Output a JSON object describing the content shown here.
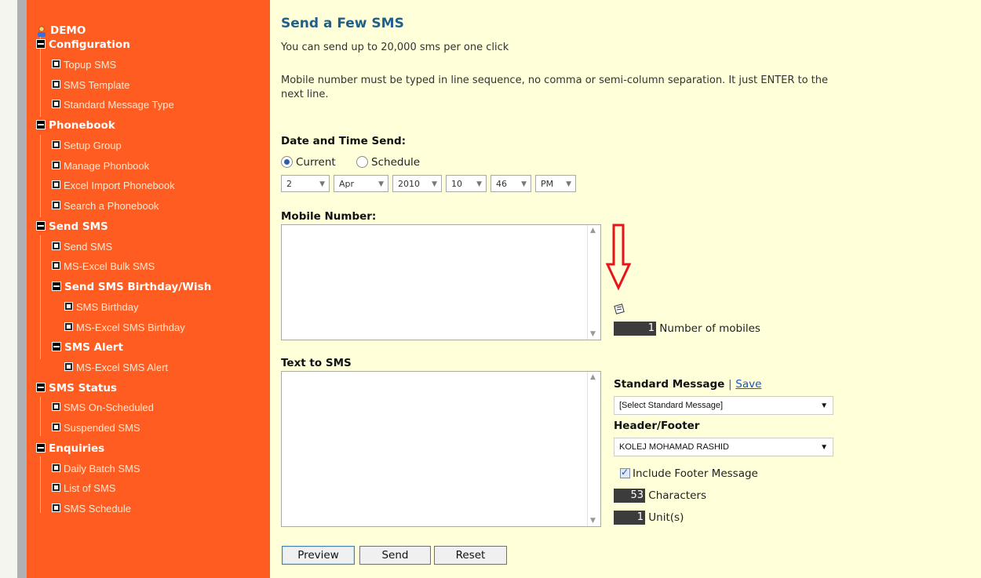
{
  "sidebar": {
    "demo": "DEMO",
    "configuration": "Configuration",
    "topup_sms": "Topup SMS",
    "sms_template": "SMS Template",
    "standard_message_type": "Standard Message Type",
    "phonebook": "Phonebook",
    "setup_group": "Setup Group",
    "manage_phonebook": "Manage Phonbook",
    "excel_import_phonebook": "Excel Import Phonebook",
    "search_phonebook": "Search a Phonebook",
    "send_sms_group": "Send SMS",
    "send_sms": "Send SMS",
    "ms_excel_bulk": "MS-Excel Bulk SMS",
    "send_birthday": "Send SMS Birthday/Wish",
    "sms_birthday": "SMS Birthday",
    "ms_excel_birthday": "MS-Excel SMS Birthday",
    "sms_alert": "SMS Alert",
    "ms_excel_alert": "MS-Excel SMS Alert",
    "sms_status": "SMS Status",
    "sms_on_scheduled": "SMS On-Scheduled",
    "suspended_sms": "Suspended SMS",
    "enquiries": "Enquiries",
    "daily_batch": "Daily Batch SMS",
    "list_of_sms": "List of SMS",
    "sms_schedule": "SMS Schedule"
  },
  "main": {
    "title": "Send a Few SMS",
    "subtitle": "You can send up to 20,000 sms per one click",
    "instruction_line1": "Mobile number must be typed in line sequence, no comma or semi-column separation. It just ENTER to the",
    "instruction_line2": "next line.",
    "date_time_label": "Date and Time Send:",
    "radio_current": "Current",
    "radio_schedule": "Schedule",
    "day": "2",
    "month": "Apr",
    "year": "2010",
    "hour": "10",
    "minute": "46",
    "ampm": "PM",
    "mobile_label": "Mobile Number:",
    "mobile_count": "1",
    "mobile_count_label": "Number of mobiles",
    "text_label": "Text to SMS",
    "standard_message_label": "Standard Message",
    "separator": "|",
    "save_link": "Save",
    "standard_message_value": "[Select Standard Message]",
    "header_footer_label": "Header/Footer",
    "header_footer_value": "KOLEJ MOHAMAD RASHID",
    "include_footer": "Include Footer Message",
    "characters_count": "53",
    "characters_label": "Characters",
    "units_count": "1",
    "units_label": "Unit(s)",
    "preview_button": "Preview",
    "send_button": "Send",
    "reset_button": "Reset"
  },
  "colors": {
    "sidebar_bg": "#ff5c21",
    "page_bg": "#ffffd9",
    "title": "#1f5f8b",
    "arrow": "#e8131b"
  }
}
